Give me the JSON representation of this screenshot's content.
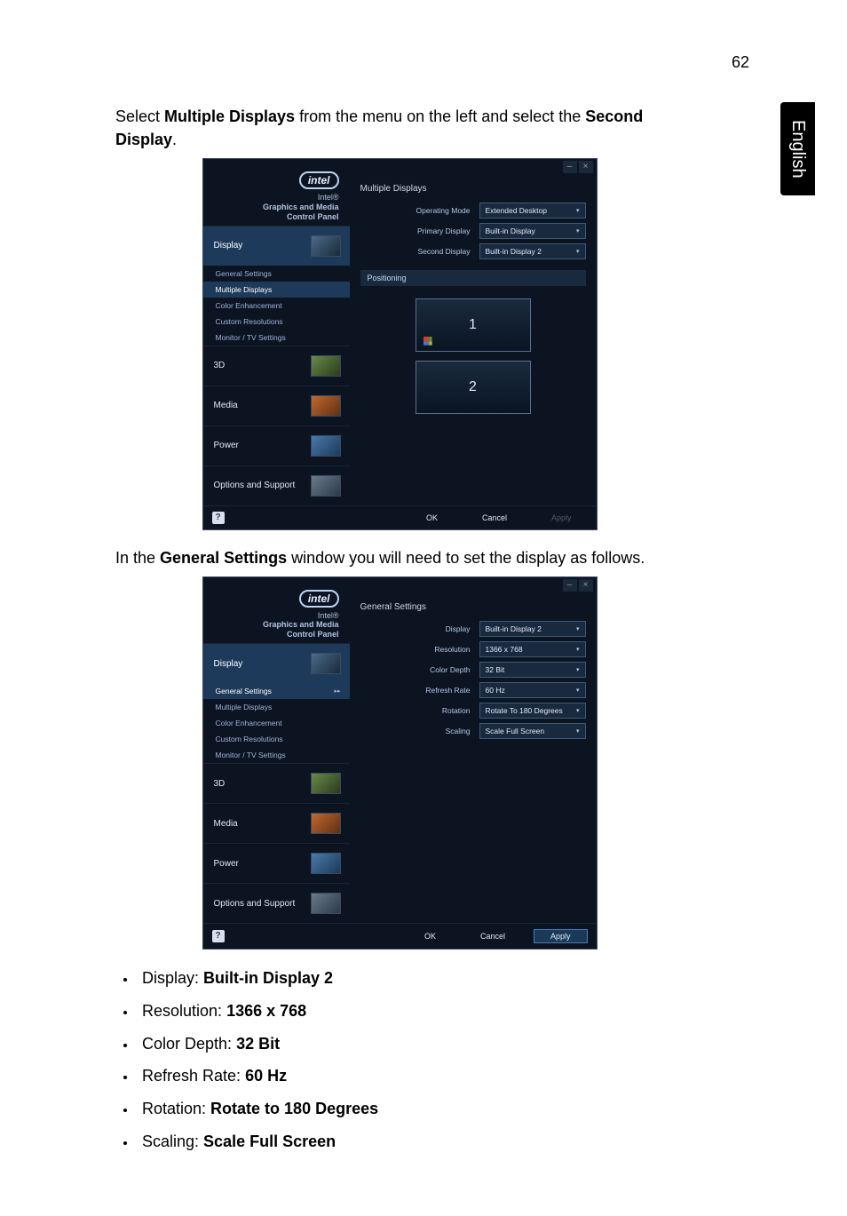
{
  "page_number": "62",
  "side_tab": "English",
  "para1_parts": [
    "Select ",
    "Multiple Displays",
    " from the menu on the left and select the ",
    "Second Display",
    "."
  ],
  "para2_parts": [
    "In the ",
    "General Settings",
    " window you will need to set the display as follows."
  ],
  "panel_shared": {
    "logo_text": "intel",
    "logo_line1": "Intel®",
    "logo_line2": "Graphics and Media",
    "logo_line3": "Control Panel",
    "min_btn": "–",
    "close_btn": "×",
    "nav_display": "Display",
    "sub_general": "General Settings",
    "sub_multiple": "Multiple Displays",
    "sub_color": "Color Enhancement",
    "sub_custom": "Custom Resolutions",
    "sub_monitor": "Monitor / TV Settings",
    "nav_3d": "3D",
    "nav_media": "Media",
    "nav_power": "Power",
    "nav_options": "Options and Support",
    "help": "?",
    "ok": "OK",
    "cancel": "Cancel",
    "apply": "Apply"
  },
  "panel1": {
    "title": "Multiple Displays",
    "fields": {
      "operating_mode_label": "Operating Mode",
      "operating_mode_value": "Extended Desktop",
      "primary_label": "Primary Display",
      "primary_value": "Built-in Display",
      "second_label": "Second Display",
      "second_value": "Built-in Display 2"
    },
    "positioning_label": "Positioning",
    "monitor1": "1",
    "monitor2": "2"
  },
  "panel2": {
    "title": "General Settings",
    "fields": {
      "display_label": "Display",
      "display_value": "Built-in Display 2",
      "resolution_label": "Resolution",
      "resolution_value": "1366 x 768",
      "color_depth_label": "Color Depth",
      "color_depth_value": "32 Bit",
      "refresh_label": "Refresh Rate",
      "refresh_value": "60 Hz",
      "rotation_label": "Rotation",
      "rotation_value": "Rotate To 180 Degrees",
      "scaling_label": "Scaling",
      "scaling_value": "Scale Full Screen"
    }
  },
  "bullets": [
    {
      "label": "Display: ",
      "value": "Built-in Display 2"
    },
    {
      "label": "Resolution: ",
      "value": "1366 x 768"
    },
    {
      "label": "Color Depth: ",
      "value": "32 Bit"
    },
    {
      "label": "Refresh Rate: ",
      "value": "60 Hz"
    },
    {
      "label": "Rotation: ",
      "value": "Rotate to 180 Degrees"
    },
    {
      "label": "Scaling: ",
      "value": "Scale Full Screen"
    }
  ]
}
